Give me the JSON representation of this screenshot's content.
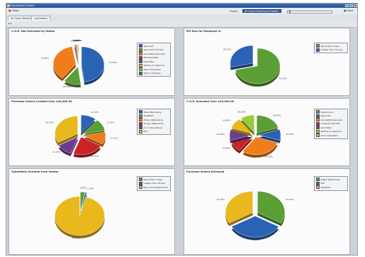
{
  "window": {
    "title": "Dashboard Graphs"
  },
  "toolbar": {
    "close_label": "Close",
    "graph_label": "Graph",
    "graph_selected": "All Graph Dashboard Details",
    "save_label": "Save"
  },
  "tabs": [
    "All Graph Details",
    "Log Details"
  ],
  "expander": {
    "label": "▸ ▸"
  },
  "colors": {
    "blue": "#2a63b4",
    "green": "#5a9e34",
    "orange": "#f07d1c",
    "red": "#c9232a",
    "yellow": "#e8b81c",
    "purple": "#6d3c91",
    "lime": "#9acb3a",
    "teal": "#1b8a8c",
    "grey": "#8c8c8c"
  },
  "panels": [
    {
      "title": "C.O.R. Not Executed by Status",
      "legend": [
        [
          "Approved",
          "#2a63b4"
        ],
        [
          "Approved-Low Time",
          "#5a9e34"
        ],
        [
          "Cancel/Not Approved",
          "#f07d1c"
        ],
        [
          "Not Submitted",
          "#c9232a"
        ],
        [
          "Submitted",
          "#6d3c91"
        ],
        [
          "Waiting on Approval",
          "#e8b81c"
        ],
        [
          "Work Completed",
          "#9acb3a"
        ],
        [
          "Work in Progress",
          "#1b8a8c"
        ]
      ],
      "chart_data": {
        "type": "pie",
        "series": [
          {
            "values": [
              47.95,
              12.33,
              37.0,
              0.68,
              0.68,
              0.68,
              0.68,
              0.0
            ]
          }
        ]
      }
    },
    {
      "title": "RFI Due for Response in",
      "legend": [
        [
          "Same than 0 days",
          "#5a9e34"
        ],
        [
          "Greater than 30 days",
          "#2a63b4"
        ]
      ],
      "chart_data": {
        "type": "pie",
        "series": [
          {
            "values": [
              71.43,
              28.57
            ]
          }
        ]
      }
    },
    {
      "title": "Purchase Orders Created Over $20,000.00",
      "legend": [
        [
          "Mass Waferswing",
          "#2a63b4"
        ],
        [
          "Weighfart",
          "#5a9e34"
        ],
        [
          "Allison Waferswing",
          "#f07d1c"
        ],
        [
          "AH Iyer Waferswing",
          "#c9232a"
        ],
        [
          "A I.T. International",
          "#6d3c91"
        ],
        [
          "SDT",
          "#e8b81c"
        ]
      ],
      "chart_data": {
        "type": "pie",
        "series": [
          {
            "values": [
              11.11,
              11.11,
              11.11,
              22.22,
              11.11,
              33.33
            ]
          }
        ]
      }
    },
    {
      "title": "C.O.R. Executed Over $20,000.00",
      "legend": [
        [
          "Signed upon",
          "#5a9e34"
        ],
        [
          "Approved",
          "#2a63b4"
        ],
        [
          "Cancel/Not Approved",
          "#f07d1c"
        ],
        [
          "Originally $34,786",
          "#c9232a"
        ],
        [
          "Submitted",
          "#6d3c91"
        ],
        [
          "Waiting on Approval",
          "#e8b81c"
        ],
        [
          "Work Completed",
          "#9acb3a"
        ]
      ],
      "chart_data": {
        "type": "pie",
        "series": [
          {
            "values": [
              20.0,
              10.0,
              30.0,
              10.0,
              10.0,
              10.0,
              10.0
            ]
          }
        ]
      }
    },
    {
      "title": "Submittals Overdue from Vendor",
      "legend": [
        [
          "Same than 0 days",
          "#5a9e34"
        ],
        [
          "Greater than 30 days",
          "#2a63b4"
        ],
        [
          "Not_Overdue(Null Field)",
          "#e8b81c"
        ]
      ],
      "chart_data": {
        "type": "pie",
        "series": [
          {
            "values": [
              2.99,
              1.0,
              96.01
            ]
          }
        ]
      }
    },
    {
      "title": "Purchase Orders Released",
      "legend": [
        [
          "Patten Waferswing",
          "#5a9e34"
        ],
        [
          "SDT",
          "#2a63b4"
        ],
        [
          "Weighfart",
          "#e8b81c"
        ]
      ],
      "chart_data": {
        "type": "pie",
        "series": [
          {
            "values": [
              33.33,
              33.33,
              33.33
            ]
          }
        ]
      }
    }
  ]
}
